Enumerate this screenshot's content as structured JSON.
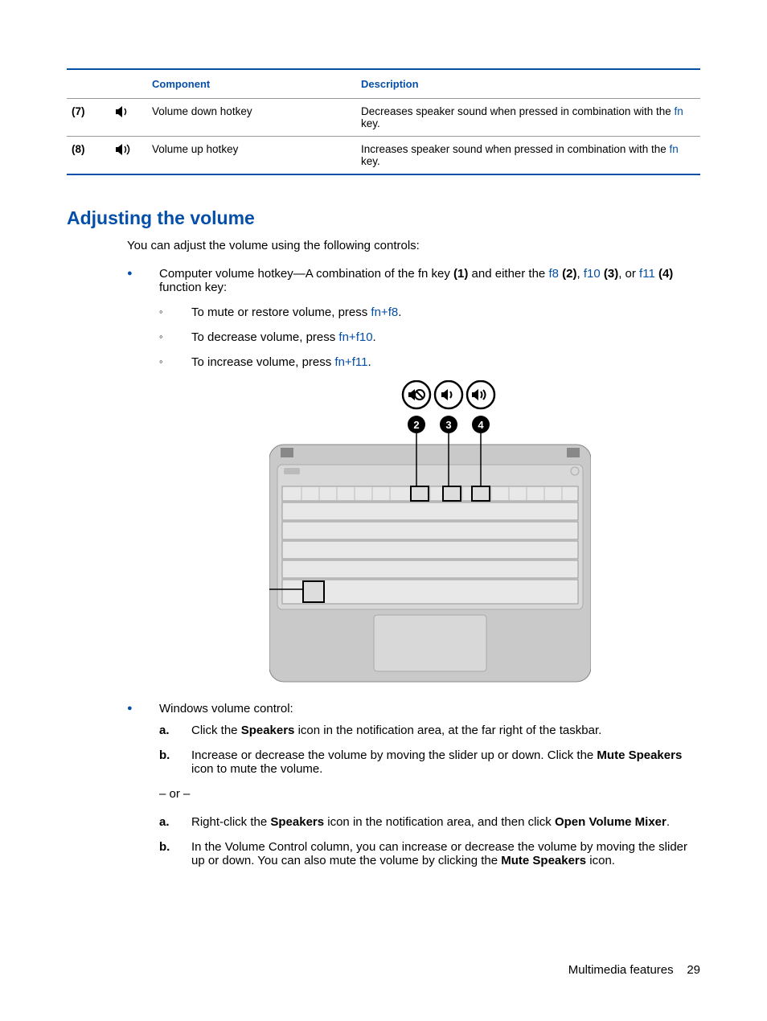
{
  "table": {
    "header": {
      "component": "Component",
      "description": "Description"
    },
    "rows": [
      {
        "num": "(7)",
        "name": "Volume down hotkey",
        "desc_before": "Decreases speaker sound when pressed in combination with the ",
        "fn_text": "fn",
        "desc_after": " key."
      },
      {
        "num": "(8)",
        "name": "Volume up hotkey",
        "desc_before": "Increases speaker sound when pressed in combination with the ",
        "fn_text": "fn",
        "desc_after": " key."
      }
    ]
  },
  "heading": "Adjusting the volume",
  "intro": "You can adjust the volume using the following controls:",
  "bullet1": {
    "text_a": "Computer volume hotkey—A combination of the fn key ",
    "b1": "(1)",
    "text_b": " and either the ",
    "f8": "f8",
    "b2": "(2)",
    "sep1": ", ",
    "f10": "f10",
    "b3": "(3)",
    "sep2": ", or ",
    "f11": "f11",
    "b4": "(4)",
    "text_c": " function key:",
    "sub": [
      {
        "pre": "To mute or restore volume, press ",
        "key": "fn+f8",
        "post": "."
      },
      {
        "pre": "To decrease volume, press ",
        "key": "fn+f10",
        "post": "."
      },
      {
        "pre": "To increase volume, press ",
        "key": "fn+f11",
        "post": "."
      }
    ]
  },
  "bullet2": {
    "title": "Windows volume control:",
    "list_a": [
      {
        "m": "a.",
        "parts": [
          "Click the ",
          "Speakers",
          " icon in the notification area, at the far right of the taskbar."
        ]
      },
      {
        "m": "b.",
        "parts": [
          "Increase or decrease the volume by moving the slider up or down. Click the ",
          "Mute Speakers",
          " icon to mute the volume."
        ]
      }
    ],
    "or_text": "– or –",
    "list_b": [
      {
        "m": "a.",
        "parts": [
          "Right-click the ",
          "Speakers",
          " icon in the notification area, and then click ",
          "Open Volume Mixer",
          "."
        ]
      },
      {
        "m": "b.",
        "parts": [
          "In the Volume Control column, you can increase or decrease the volume by moving the slider up or down. You can also mute the volume by clicking the ",
          "Mute Speakers",
          " icon."
        ]
      }
    ]
  },
  "footer": {
    "section": "Multimedia features",
    "page": "29"
  }
}
